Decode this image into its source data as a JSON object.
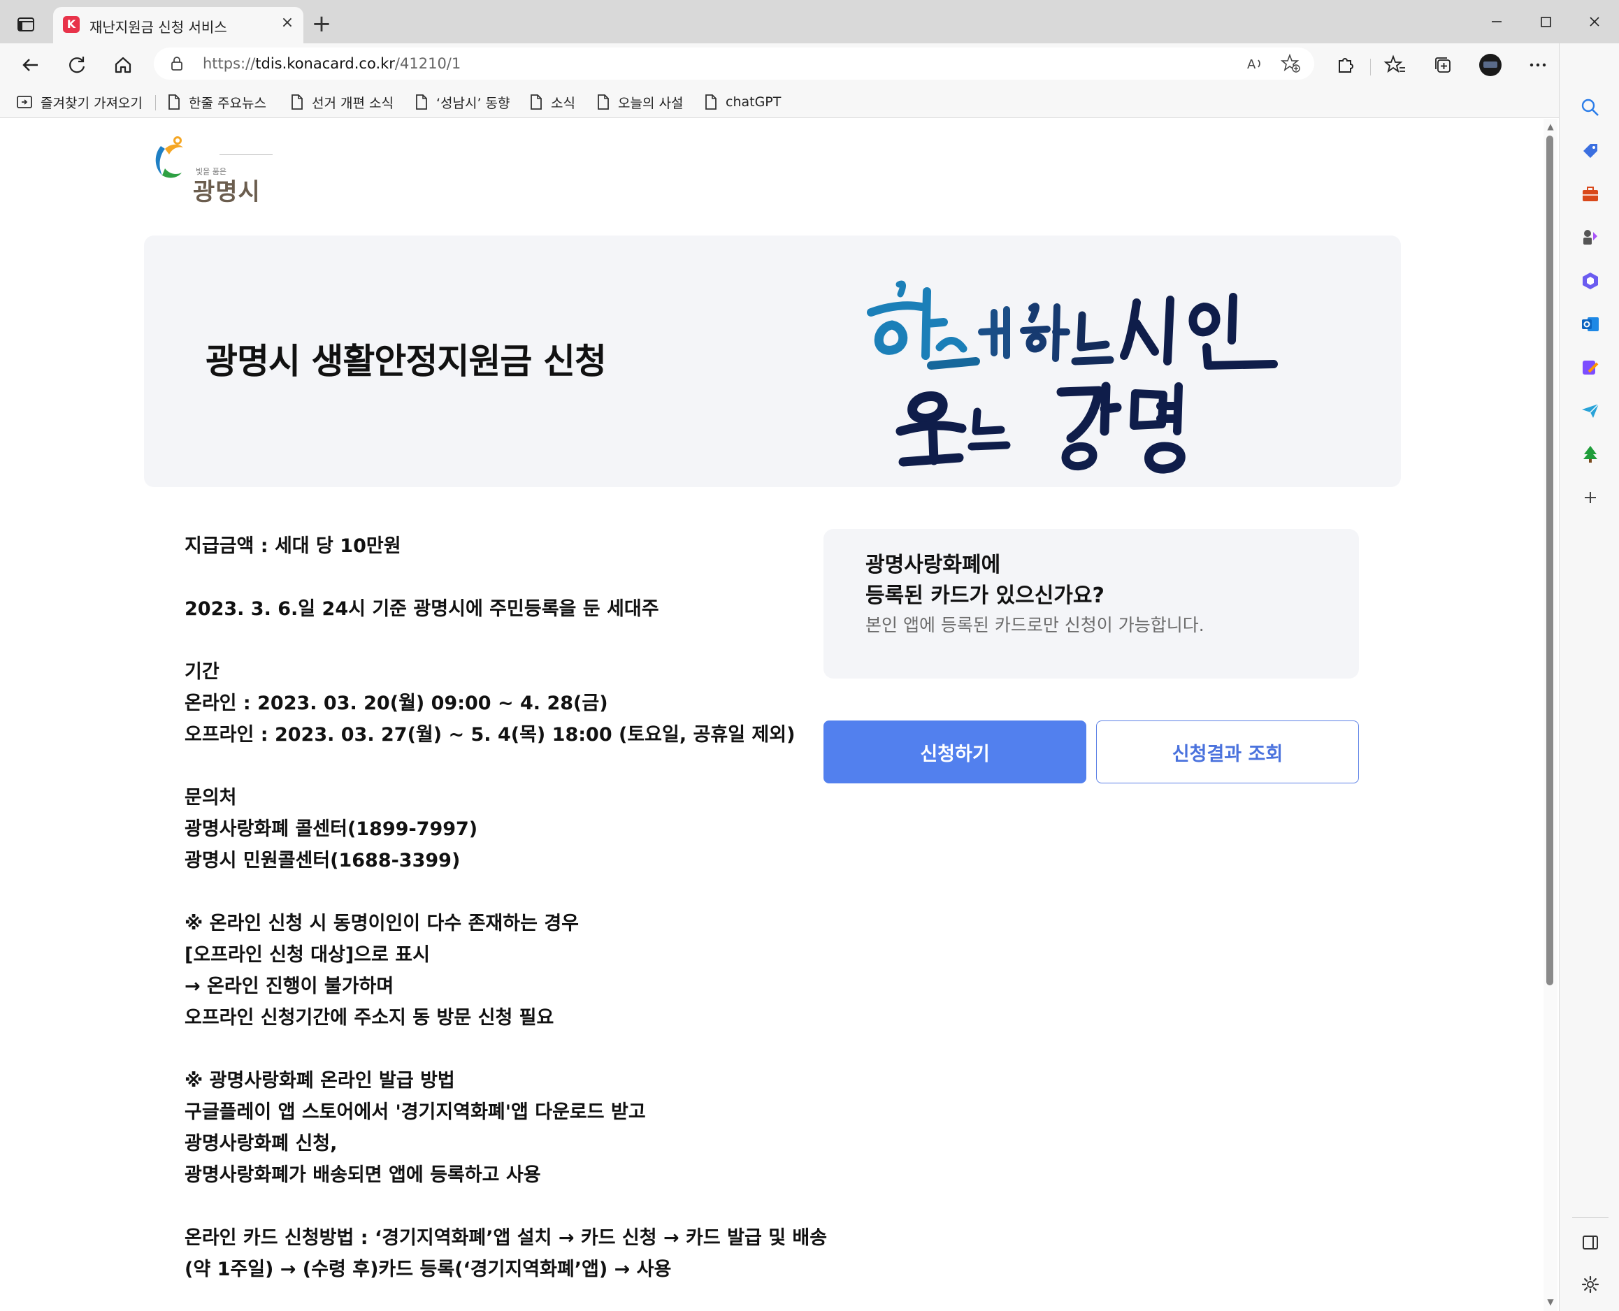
{
  "browser": {
    "tab_title": "재난지원금 신청 서비스",
    "url_prefix": "https://",
    "url_host": "tdis.konacard.co.kr",
    "url_path": "/41210/1",
    "new_tab": "+",
    "close": "×"
  },
  "bookmarks": [
    {
      "label": "즐겨찾기 가져오기",
      "icon": "import-favorites-icon"
    },
    {
      "label": "한줄 주요뉴스",
      "icon": "page-icon"
    },
    {
      "label": "선거 개편 소식",
      "icon": "page-icon"
    },
    {
      "label": "‘성남시’ 동향",
      "icon": "page-icon"
    },
    {
      "label": "소식",
      "icon": "page-icon"
    },
    {
      "label": "오늘의 사설",
      "icon": "page-icon"
    },
    {
      "label": "chatGPT",
      "icon": "page-icon"
    }
  ],
  "logo": {
    "small_text": "빛을 품은",
    "city": "광명시"
  },
  "hero": {
    "title": "광명시 생활안정지원금 신청"
  },
  "info": {
    "amount": "지급금액 : 세대 당 10만원",
    "eligibility": "2023. 3. 6.일 24시 기준 광명시에 주민등록을 둔 세대주",
    "period_heading": "기간",
    "period_online": "온라인 : 2023. 03. 20(월) 09:00 ~ 4. 28(금)",
    "period_offline": "오프라인 : 2023. 03. 27(월) ~ 5. 4(목) 18:00 (토요일, 공휴일 제외)",
    "contact_heading": "문의처",
    "contact_1": "광명사랑화폐 콜센터(1899-7997)",
    "contact_2": "광명시 민원콜센터(1688-3399)",
    "note1_1": "※ 온라인 신청 시 동명이인이 다수 존재하는 경우",
    "note1_2": "[오프라인 신청 대상]으로 표시",
    "note1_3": "→ 온라인 진행이 불가하며",
    "note1_4": "오프라인 신청기간에 주소지 동 방문 신청 필요",
    "note2_1": "※ 광명사랑화폐 온라인 발급 방법",
    "note2_2": "구글플레이 앱 스토어에서 '경기지역화폐'앱 다운로드 받고",
    "note2_3": "광명사랑화폐 신청,",
    "note2_4": "광명사랑화폐가 배송되면 앱에 등록하고 사용",
    "method_1": "온라인 카드 신청방법 : ‘경기지역화폐’앱 설치 → 카드 신청 → 카드 발급 및 배송",
    "method_2": "(약 1주일) → (수령 후)카드 등록(‘경기지역화폐’앱) → 사용"
  },
  "card_check": {
    "question_line1": "광명사랑화폐에",
    "question_line2": "등록된 카드가 있으신가요?",
    "note": "본인 앱에 등록된 카드로만 신청이 가능합니다."
  },
  "buttons": {
    "apply": "신청하기",
    "result": "신청결과 조회"
  },
  "colors": {
    "primary": "#5280ee",
    "panel_bg": "#f4f5f8",
    "slogan_blue": "#1b7fb8",
    "slogan_navy": "#0f1d4a"
  }
}
